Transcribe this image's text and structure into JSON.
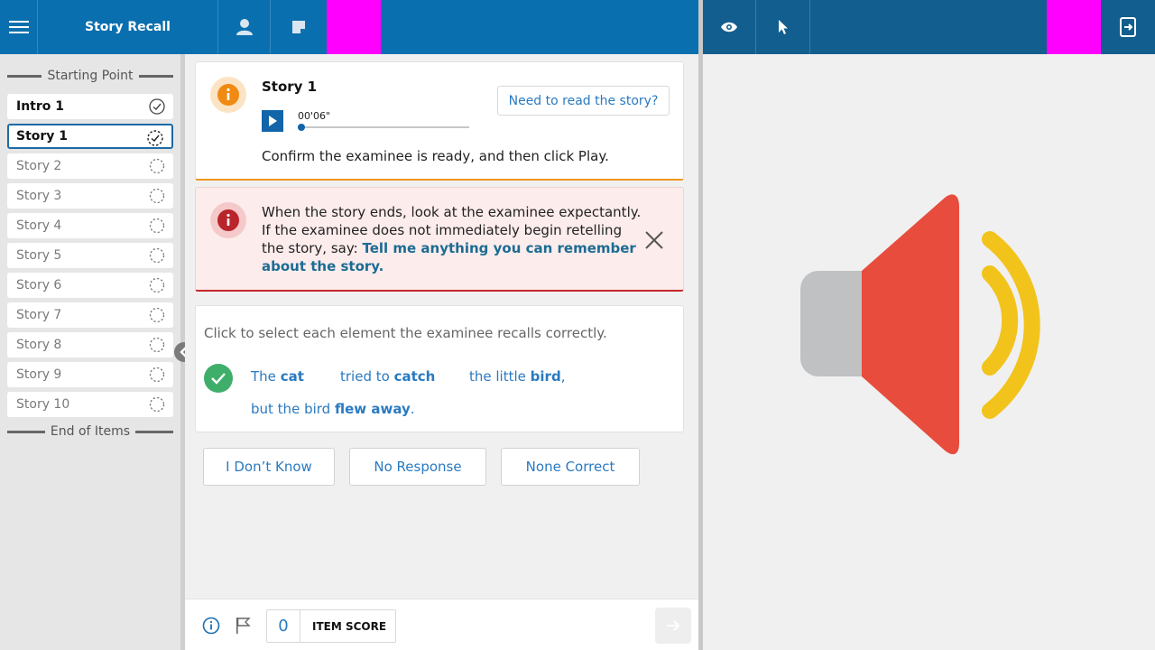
{
  "header": {
    "app_title": "Story Recall",
    "left_icons": [
      "menu-icon",
      "person-icon",
      "note-icon"
    ],
    "right_icons": [
      "eye-icon",
      "pointer-icon",
      "exit-tablet-icon"
    ]
  },
  "sidebar": {
    "start_label": "Starting Point",
    "end_label": "End of Items",
    "items": [
      {
        "label": "Intro 1",
        "status": "done"
      },
      {
        "label": "Story 1",
        "status": "active"
      },
      {
        "label": "Story 2",
        "status": "pending"
      },
      {
        "label": "Story 3",
        "status": "pending"
      },
      {
        "label": "Story 4",
        "status": "pending"
      },
      {
        "label": "Story 5",
        "status": "pending"
      },
      {
        "label": "Story 6",
        "status": "pending"
      },
      {
        "label": "Story 7",
        "status": "pending"
      },
      {
        "label": "Story 8",
        "status": "pending"
      },
      {
        "label": "Story 9",
        "status": "pending"
      },
      {
        "label": "Story 10",
        "status": "pending"
      }
    ]
  },
  "story_card": {
    "title": "Story 1",
    "time": "00'06\"",
    "progress": 0.02,
    "read_button": "Need to read the story?",
    "instruction": "Confirm the examinee is ready, and then click Play."
  },
  "alert_card": {
    "text": "When the story ends, look at the examinee expectantly. If the examinee does not immediately begin retelling the story, say:",
    "prompt": "Tell me anything you can remember about the story."
  },
  "recall_card": {
    "instruction": "Click to select each element the examinee recalls correctly.",
    "elements": [
      {
        "plain": "The",
        "bold": "cat",
        "suffix": ""
      },
      {
        "plain": "tried to",
        "bold": "catch",
        "suffix": ""
      },
      {
        "plain": "the little",
        "bold": "bird",
        "suffix": ","
      },
      {
        "plain": "but the bird",
        "bold": "flew away",
        "suffix": "."
      }
    ]
  },
  "responses": {
    "dont_know": "I Don’t Know",
    "no_response": "No Response",
    "none_correct": "None Correct"
  },
  "footer": {
    "score_value": "0",
    "score_label": "ITEM SCORE"
  },
  "colors": {
    "header_left": "#0a6fae",
    "header_right": "#125e8e",
    "accent_orange": "#f0951e",
    "alert_red": "#c4272d",
    "link_blue": "#2a7ac0",
    "success_green": "#3fae6b",
    "speaker_red": "#e74c3c",
    "speaker_yellow": "#f2c31b",
    "speaker_gray": "#bfc1c3"
  }
}
